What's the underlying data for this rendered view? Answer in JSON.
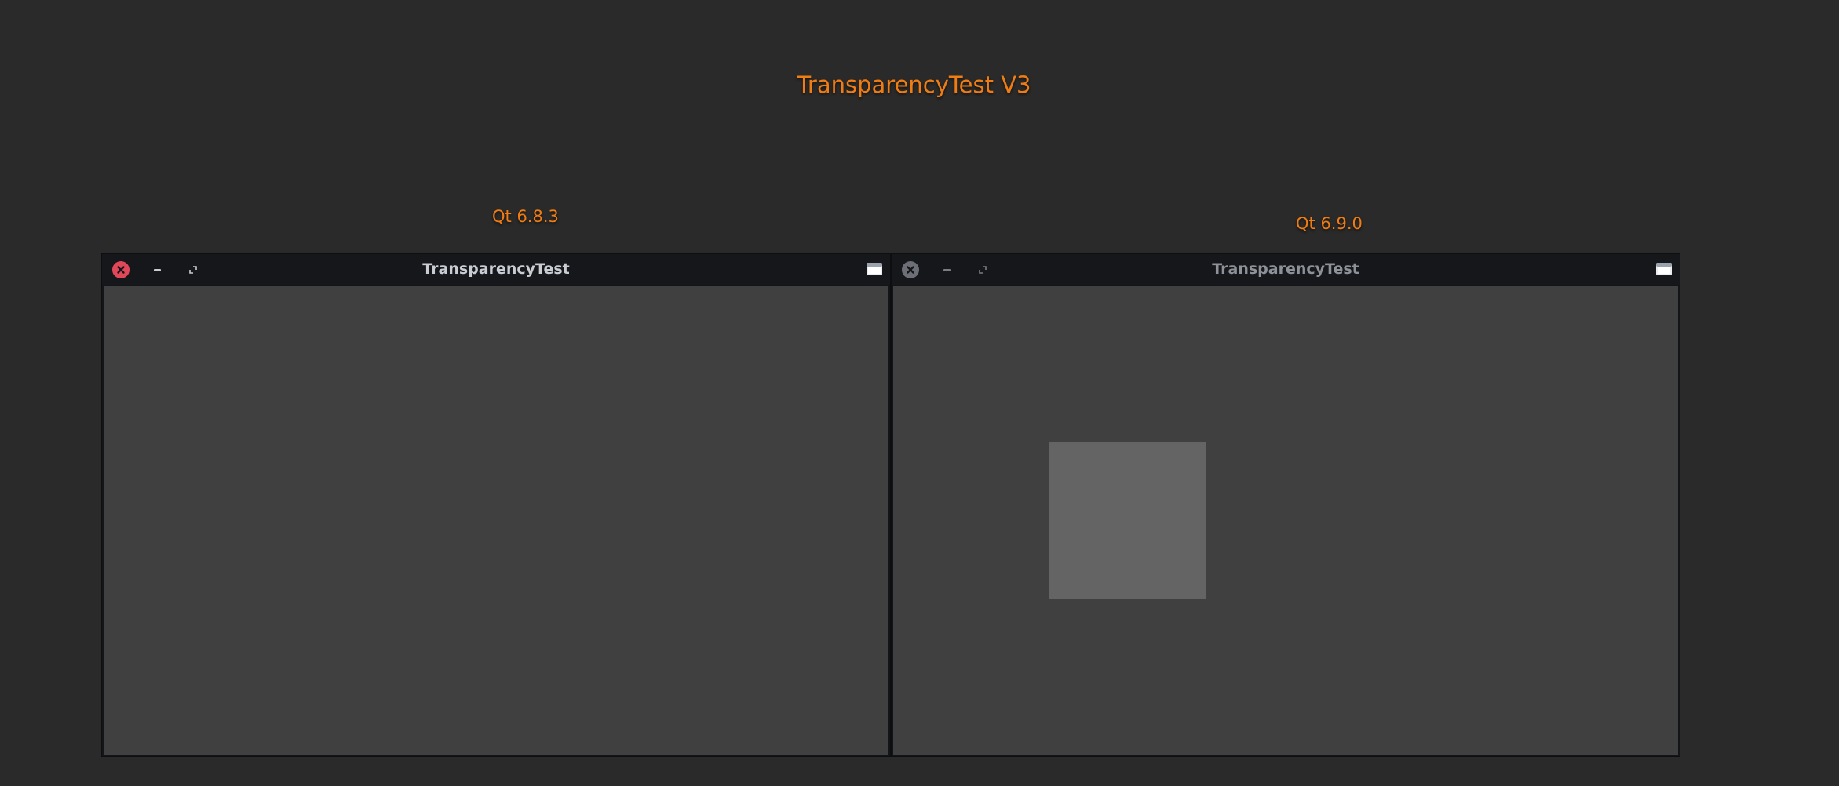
{
  "page": {
    "title": "TransparencyTest V3"
  },
  "left": {
    "version_label": "Qt 6.8.3",
    "window_title": "TransparencyTest",
    "state": "active"
  },
  "right": {
    "version_label": "Qt 6.9.0",
    "window_title": "TransparencyTest",
    "state": "inactive"
  },
  "icons": {
    "close": "close-icon",
    "minimize": "minimize-icon",
    "maximize": "maximize-icon",
    "window_menu": "window-menu-icon"
  },
  "colors": {
    "background": "#2a2a2a",
    "accent_text": "#f07d13",
    "titlebar": "#16171b",
    "client_area": "#404040",
    "square": "#646464",
    "close_active": "#e0485a",
    "close_inactive": "#6c6f75"
  }
}
